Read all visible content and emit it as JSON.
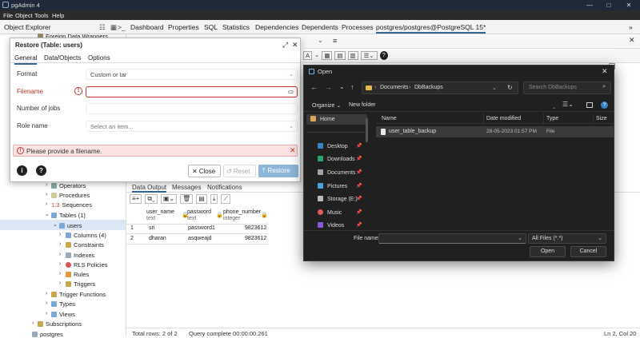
{
  "app": {
    "title": "pgAdmin 4"
  },
  "menu": [
    "File",
    "Object",
    "Tools",
    "Help"
  ],
  "tabs": {
    "object_explorer": "Object Explorer",
    "items": [
      "Dashboard",
      "Properties",
      "SQL",
      "Statistics",
      "Dependencies",
      "Dependents",
      "Processes"
    ],
    "query_tab": "postgres/postgres@PostgreSQL 15*"
  },
  "tree": {
    "foreign_data_wrappers": "Foreign Data Wrappers",
    "operators": "Operators",
    "procedures": "Procedures",
    "sequences": "Sequences",
    "tables": "Tables (1)",
    "users": "users",
    "columns": "Columns (4)",
    "constraints": "Constraints",
    "indexes": "Indexes",
    "rls": "RLS Policies",
    "rules": "Rules",
    "triggers": "Triggers",
    "trigger_functions": "Trigger Functions",
    "types": "Types",
    "views": "Views",
    "subscriptions": "Subscriptions",
    "postgres": "postgres"
  },
  "restore": {
    "title": "Restore (Table: users)",
    "tabs": [
      "General",
      "Data/Objects",
      "Options"
    ],
    "format_label": "Format",
    "format_value": "Custom or tar",
    "filename_label": "Filename",
    "filename_value": "",
    "jobs_label": "Number of jobs",
    "jobs_value": "",
    "role_label": "Role name",
    "role_placeholder": "Select an item...",
    "error": "Please provide a filename.",
    "close": "Close",
    "reset": "Reset",
    "restore": "Restore"
  },
  "results": {
    "tabs": [
      "Data Output",
      "Messages",
      "Notifications"
    ],
    "columns": [
      {
        "name": "user_name",
        "type": "text"
      },
      {
        "name": "password",
        "type": "text"
      },
      {
        "name": "phone_number",
        "type": "integer"
      }
    ],
    "rows": [
      {
        "n": "1",
        "user_name": "sri",
        "password": "password1",
        "phone": "9823612"
      },
      {
        "n": "2",
        "user_name": "dharan",
        "password": "asqweajd",
        "phone": "9823612"
      }
    ],
    "status_total": "Total rows: 2 of 2",
    "status_query": "Query complete 00:00:00.261",
    "status_pos": "Ln 2, Col 20"
  },
  "open": {
    "title": "Open",
    "path": [
      "Documents",
      "DbBackups"
    ],
    "search_placeholder": "Search DbBackups",
    "organize": "Organize",
    "new_folder": "New folder",
    "nav": {
      "home": "Home",
      "desktop": "Desktop",
      "downloads": "Downloads",
      "documents": "Documents",
      "pictures": "Pictures",
      "storage": "Storage (E:)",
      "music": "Music",
      "videos": "Videos"
    },
    "columns": {
      "name": "Name",
      "date": "Date modified",
      "type": "Type",
      "size": "Size"
    },
    "files": [
      {
        "name": "user_table_backup",
        "date": "28-05-2023 01:57 PM",
        "type": "File"
      }
    ],
    "filename_label": "File name:",
    "filename_value": "",
    "filter": "All Files (*.*)",
    "open_btn": "Open",
    "cancel_btn": "Cancel"
  }
}
